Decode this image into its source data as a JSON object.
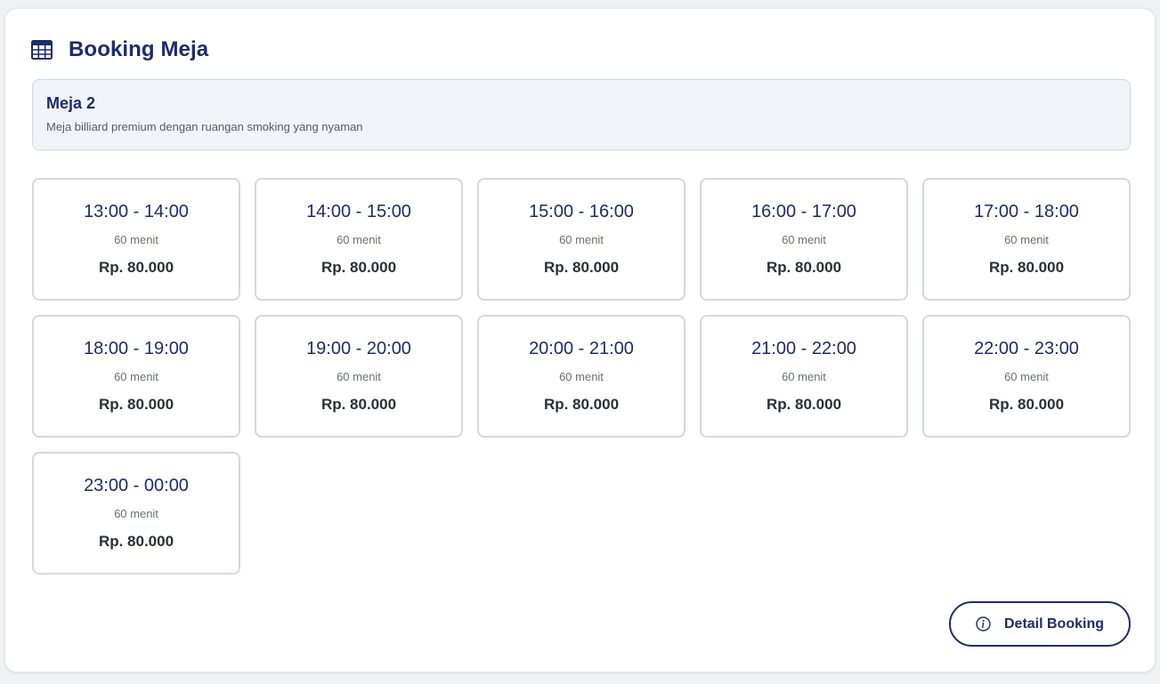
{
  "header": {
    "icon": "table-icon",
    "title": "Booking Meja"
  },
  "table_info": {
    "name": "Meja 2",
    "description": "Meja billiard premium dengan ruangan smoking yang nyaman"
  },
  "slots": [
    {
      "time": "13:00 - 14:00",
      "duration": "60 menit",
      "price": "Rp. 80.000"
    },
    {
      "time": "14:00 - 15:00",
      "duration": "60 menit",
      "price": "Rp. 80.000"
    },
    {
      "time": "15:00 - 16:00",
      "duration": "60 menit",
      "price": "Rp. 80.000"
    },
    {
      "time": "16:00 - 17:00",
      "duration": "60 menit",
      "price": "Rp. 80.000"
    },
    {
      "time": "17:00 - 18:00",
      "duration": "60 menit",
      "price": "Rp. 80.000"
    },
    {
      "time": "18:00 - 19:00",
      "duration": "60 menit",
      "price": "Rp. 80.000"
    },
    {
      "time": "19:00 - 20:00",
      "duration": "60 menit",
      "price": "Rp. 80.000"
    },
    {
      "time": "20:00 - 21:00",
      "duration": "60 menit",
      "price": "Rp. 80.000"
    },
    {
      "time": "21:00 - 22:00",
      "duration": "60 menit",
      "price": "Rp. 80.000"
    },
    {
      "time": "22:00 - 23:00",
      "duration": "60 menit",
      "price": "Rp. 80.000"
    },
    {
      "time": "23:00 - 00:00",
      "duration": "60 menit",
      "price": "Rp. 80.000"
    }
  ],
  "detail_button": {
    "icon": "info-icon",
    "label": "Detail Booking"
  },
  "colors": {
    "primary": "#1b2d6b",
    "info_box_bg": "#f1f3f8",
    "slot_border": "#d4d6e2"
  }
}
